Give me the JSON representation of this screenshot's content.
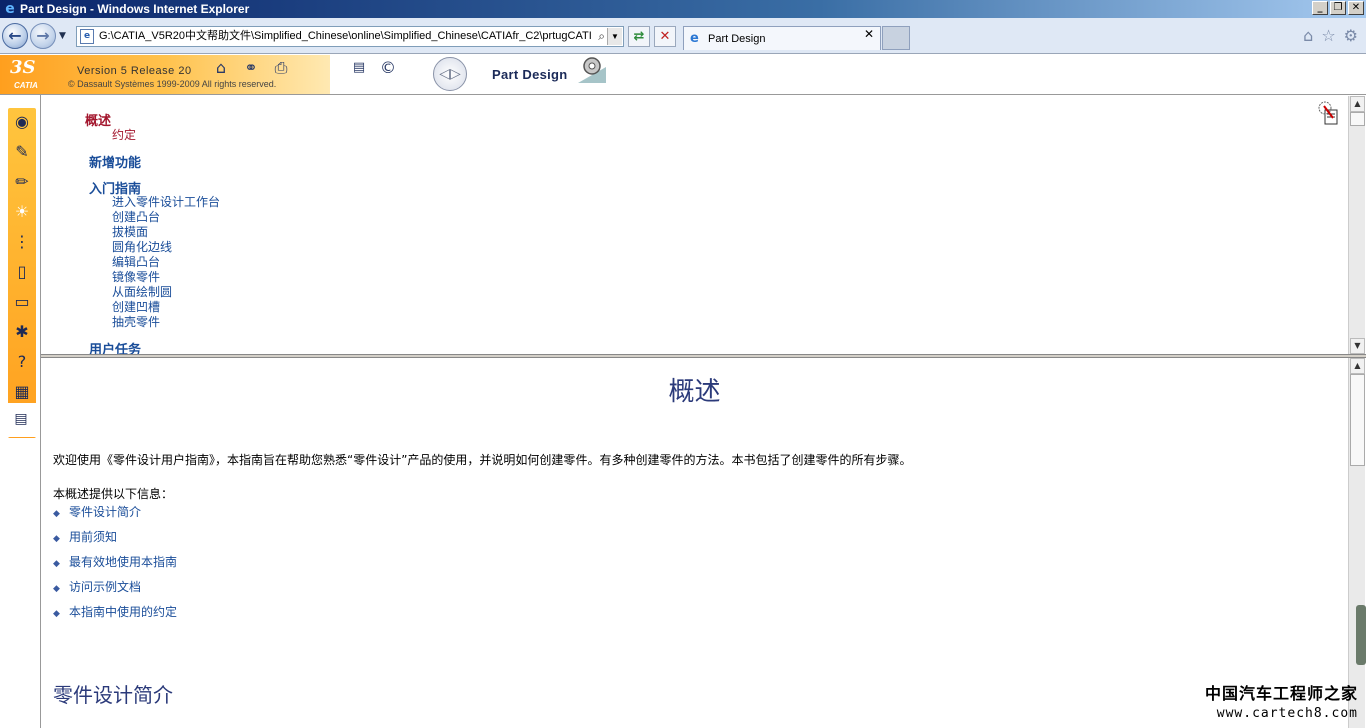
{
  "window": {
    "title": "Part Design - Windows Internet Explorer",
    "controls": [
      "_",
      "❐",
      "✕"
    ]
  },
  "navbar": {
    "address": "G:\\CATIA_V5R20中文帮助文件\\Simplified_Chinese\\online\\Simplified_Chinese\\CATIAfr_C2\\prtugCATI",
    "tab_label": "Part Design",
    "tab_close": "✕"
  },
  "catia_header": {
    "logo_ds": "3S",
    "logo_catia": "CATIA",
    "version": "Version 5 Release 20",
    "copyright": "© Dassault Systèmes 1999-2009 All rights reserved.",
    "product": "Part Design"
  },
  "toc": {
    "sections": [
      {
        "label": "概述",
        "active": true,
        "items": [
          {
            "label": "约定"
          }
        ]
      },
      {
        "label": "新增功能",
        "items": []
      },
      {
        "label": "入门指南",
        "items": [
          {
            "label": "进入零件设计工作台"
          },
          {
            "label": "创建凸台"
          },
          {
            "label": "拔模面"
          },
          {
            "label": "圆角化边线"
          },
          {
            "label": "编辑凸台"
          },
          {
            "label": "镜像零件"
          },
          {
            "label": "从面绘制圆"
          },
          {
            "label": "创建凹槽"
          },
          {
            "label": "抽壳零件"
          }
        ]
      },
      {
        "label": "用户任务",
        "items": []
      }
    ]
  },
  "content": {
    "title": "概述",
    "intro": "欢迎使用《零件设计用户指南》，本指南旨在帮助您熟悉“零件设计”产品的使用，并说明如何创建零件。有多种创建零件的方法。本书包括了创建零件的所有步骤。",
    "subheading": "本概述提供以下信息：",
    "bullets": [
      "零件设计简介",
      "用前须知",
      "最有效地使用本指南",
      "访问示例文档",
      "本指南中使用的约定"
    ],
    "section_heading": "零件设计简介"
  },
  "watermark": {
    "cn": "中国汽车工程师之家",
    "url": "www.cartech8.com"
  },
  "colors": {
    "link": "#1a4d99",
    "active": "#a3162d",
    "heading": "#2b3a7a",
    "orange": "#ff9f1e"
  }
}
